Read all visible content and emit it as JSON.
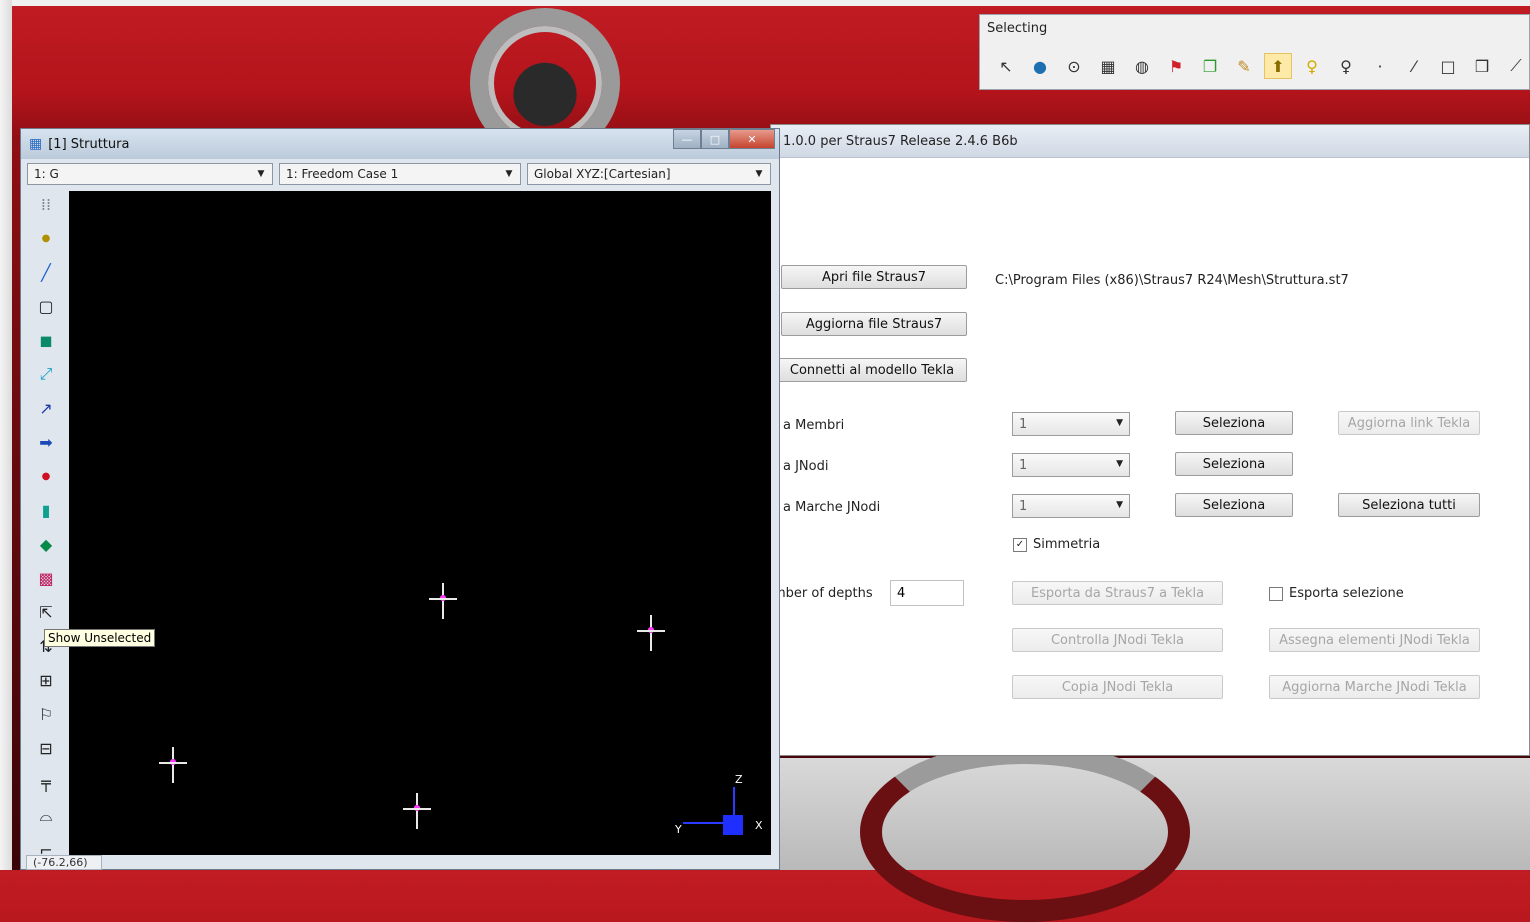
{
  "selecting_toolbar": {
    "title": "Selecting",
    "icons": [
      "pointer-icon",
      "globe-icon",
      "lasso-icon",
      "grid-icon",
      "sphere-icon",
      "flag-icon",
      "copy-icon",
      "pencil-icon",
      "pin-active-icon",
      "bulb-icon",
      "marker-icon",
      "dot-icon",
      "line-icon",
      "square-icon",
      "cube-icon",
      "polyline-icon"
    ]
  },
  "main_window": {
    "title": "1.0.0 per Straus7 Release 2.4.6 B6b",
    "open_button": "Apri file Straus7",
    "file_path": "C:\\Program Files (x86)\\Straus7 R24\\Mesh\\Struttura.st7",
    "update_button": "Aggiorna file Straus7",
    "connect_button": "Connetti al modello Tekla",
    "rows": [
      {
        "label": "a Membri",
        "combo": "1",
        "select": "Seleziona",
        "extra": "Aggiorna link Tekla",
        "extra_disabled": true
      },
      {
        "label": "a JNodi",
        "combo": "1",
        "select": "Seleziona"
      },
      {
        "label": "a Marche JNodi",
        "combo": "1",
        "select": "Seleziona",
        "extra": "Seleziona tutti",
        "extra_disabled": false
      }
    ],
    "symmetry_label": "Simmetria",
    "depths_label": "mber of depths",
    "depths_value": "4",
    "export_button": "Esporta da Straus7 a Tekla",
    "export_selection_label": "Esporta selezione",
    "check_button": "Controlla JNodi Tekla",
    "assign_button": "Assegna elementi JNodi Tekla",
    "copy_button": "Copia JNodi Tekla",
    "update_marks_button": "Aggiorna Marche JNodi Tekla"
  },
  "struttura_window": {
    "title": "[1] Struttura",
    "group_dropdown": "1: G",
    "freedom_dropdown": "1: Freedom Case 1",
    "coord_dropdown": "Global XYZ:[Cartesian]",
    "tooltip": "Show Unselected",
    "status": "(-76.2,66)",
    "axis_z": "Z",
    "axis_y": "Y",
    "axis_x": "X"
  }
}
